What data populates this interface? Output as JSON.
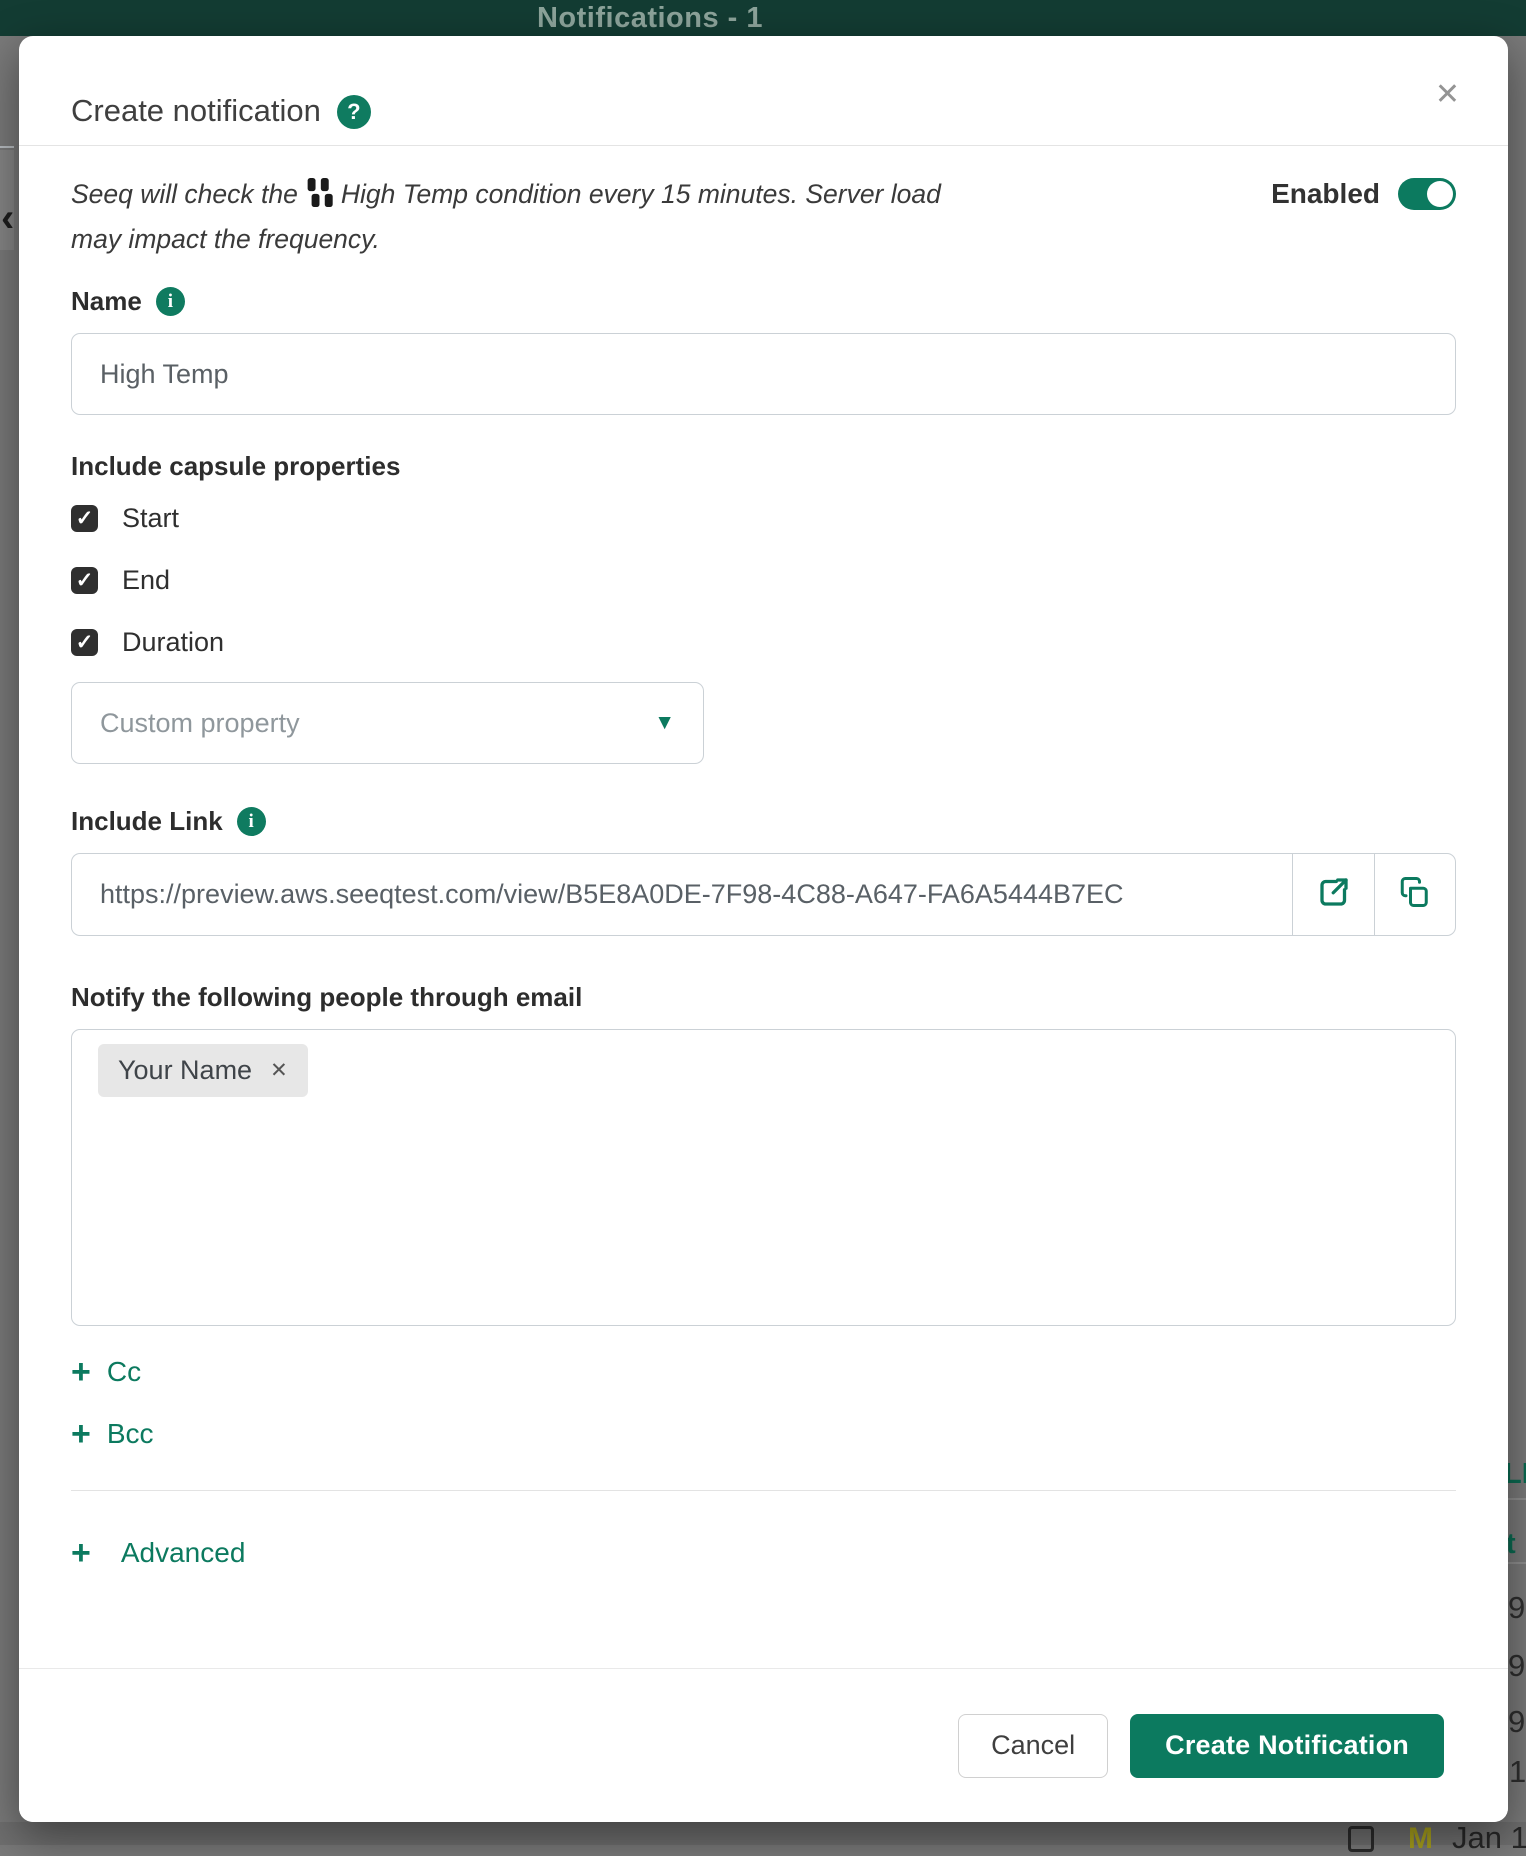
{
  "colors": {
    "accent_green": "#0c7a5f",
    "top_bar_green": "#133c33",
    "overlay_gray": "#7a7a7a",
    "checkbox_fill": "#2f2f2f",
    "primary_button": "#0c7a5f"
  },
  "background": {
    "top_bar_title": "Notifications - 1",
    "left_chevron": "‹",
    "right_edge_fragments": [
      "LE",
      "t",
      "9",
      "9",
      "9",
      "1"
    ],
    "bottom_edge": {
      "workbook_badge": "M",
      "date_fragment": "Jan 1"
    }
  },
  "modal": {
    "title": "Create notification",
    "icons": {
      "help": "?",
      "close": "✕",
      "info": "i",
      "caret_down": "▼",
      "check": "✓",
      "plus": "+",
      "chip_remove": "✕",
      "external_link": "open-in-new-icon",
      "copy": "copy-icon",
      "condition": "condition-bars-icon"
    },
    "intro": {
      "text_before_icon": "Seeq will check the",
      "text_after_icon": "High Temp condition every 15 minutes. Server load may impact the frequency."
    },
    "enabled_toggle": {
      "label": "Enabled",
      "state": "on"
    },
    "name_field": {
      "label": "Name",
      "value": "High Temp"
    },
    "capsule_properties": {
      "heading": "Include capsule properties",
      "options": [
        {
          "label": "Start",
          "checked": true
        },
        {
          "label": "End",
          "checked": true
        },
        {
          "label": "Duration",
          "checked": true
        }
      ],
      "custom_property_placeholder": "Custom property"
    },
    "include_link": {
      "heading": "Include Link",
      "url": "https://preview.aws.seeqtest.com/view/B5E8A0DE-7F98-4C88-A647-FA6A5444B7EC"
    },
    "notify": {
      "heading": "Notify the following people through email",
      "recipients": [
        {
          "name": "Your Name"
        }
      ],
      "cc_label": "Cc",
      "bcc_label": "Bcc"
    },
    "advanced_label": "Advanced",
    "footer": {
      "cancel_label": "Cancel",
      "submit_label": "Create Notification"
    }
  }
}
